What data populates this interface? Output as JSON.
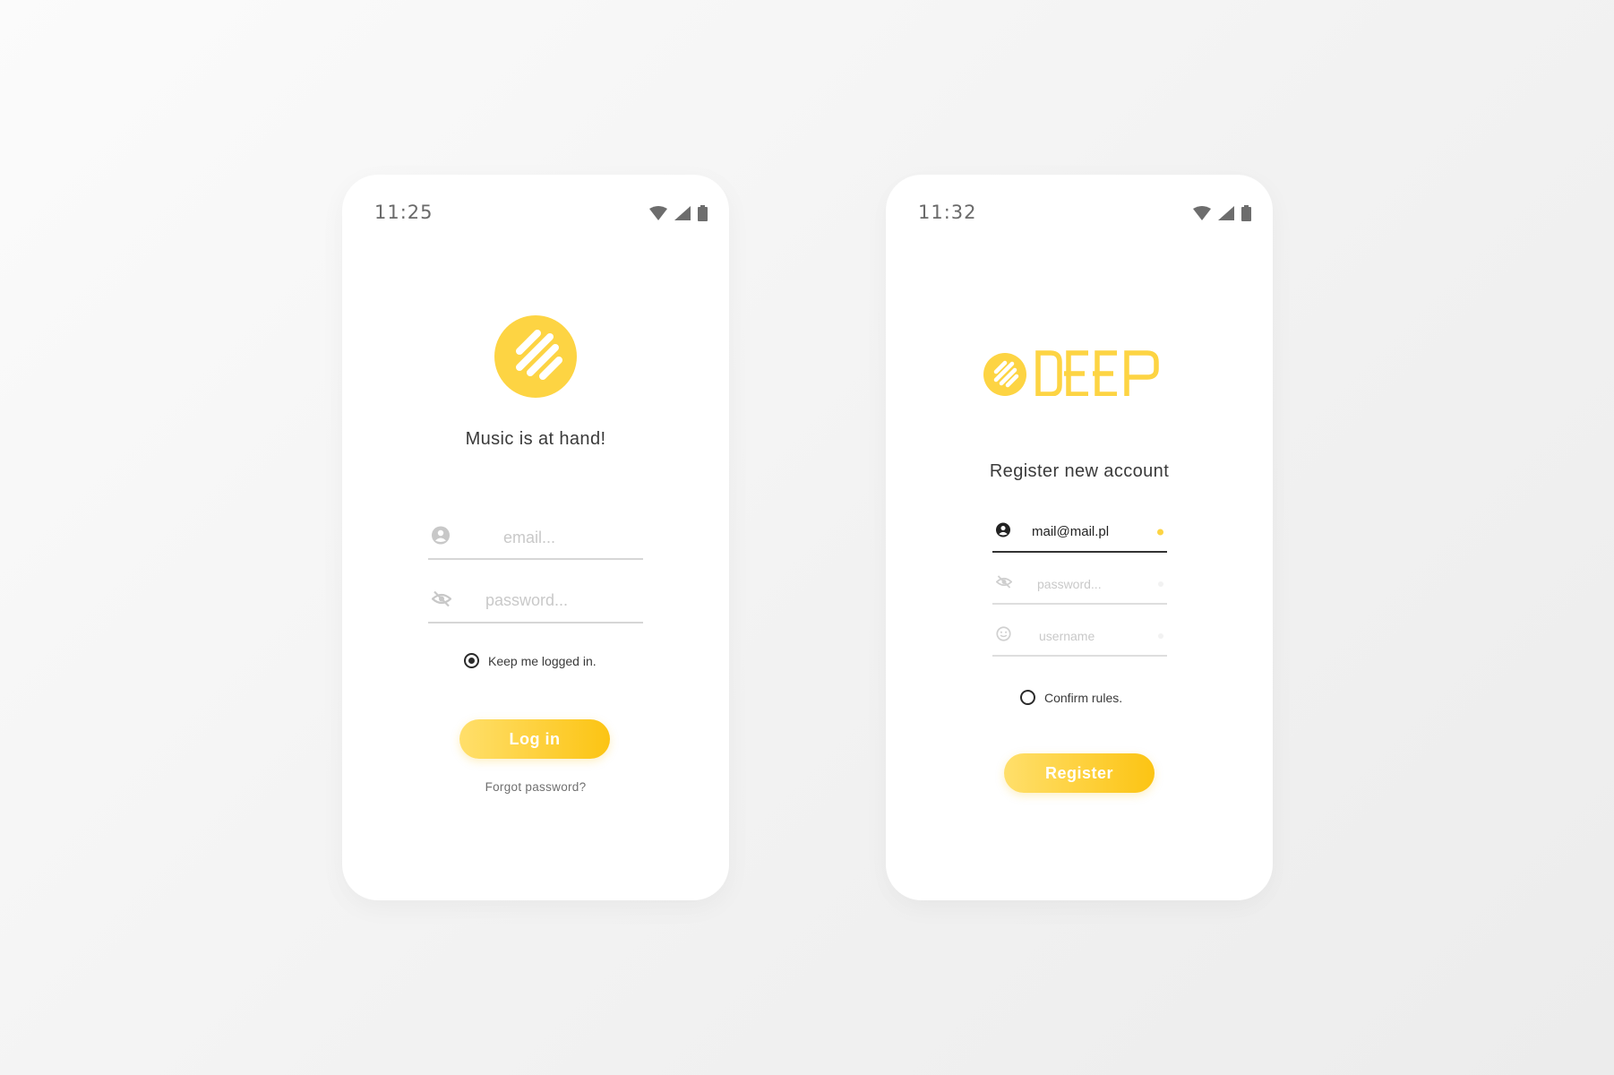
{
  "colors": {
    "accent": "#fdd443",
    "accent_dark": "#fcc413",
    "text": "#3a3a3a",
    "muted": "#c9c9c9"
  },
  "login_screen": {
    "status": {
      "time": "11:25",
      "icons": [
        "wifi-icon",
        "signal-icon",
        "battery-icon"
      ]
    },
    "logo_icon": "music-logo-icon",
    "tagline": "Music is at hand!",
    "email": {
      "value": "",
      "placeholder": "email...",
      "icon": "user-icon"
    },
    "password": {
      "value": "",
      "placeholder": "password...",
      "icon": "eye-off-icon"
    },
    "keep_logged_in": {
      "label": "Keep me logged in.",
      "checked": true
    },
    "login_button": "Log in",
    "forgot_password": "Forgot password?"
  },
  "register_screen": {
    "status": {
      "time": "11:32",
      "icons": [
        "wifi-icon",
        "signal-icon",
        "battery-icon"
      ]
    },
    "wordmark": "DEEP",
    "title": "Register new account",
    "email": {
      "value": "mail@mail.pl",
      "placeholder": "",
      "icon": "user-icon"
    },
    "password": {
      "value": "",
      "placeholder": "password...",
      "icon": "eye-off-icon"
    },
    "username": {
      "value": "",
      "placeholder": "username",
      "icon": "smile-icon"
    },
    "confirm_rules": {
      "label": "Confirm rules.",
      "checked": false
    },
    "register_button": "Register"
  }
}
